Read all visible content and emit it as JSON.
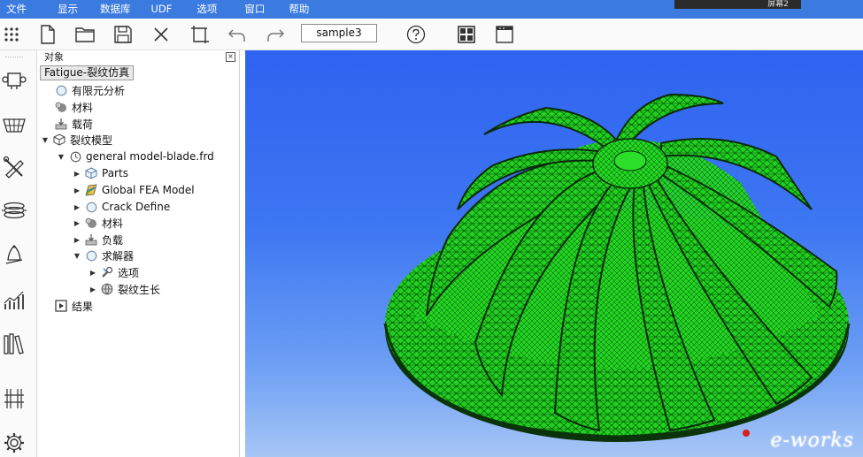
{
  "menu": [
    "文件",
    "显示",
    "数据库",
    "UDF",
    "选项",
    "窗口",
    "帮助"
  ],
  "screen_tag": "屏幕2",
  "toolbar": {
    "project_name": "sample3"
  },
  "panel": {
    "title": "对象",
    "close_glyph": "×"
  },
  "tree": {
    "root": "Fatigue-裂纹仿真",
    "fea": "有限元分析",
    "material": "材料",
    "load": "载荷",
    "crack_model": "裂纹模型",
    "file": "general model-blade.frd",
    "parts": "Parts",
    "global_fea": "Global FEA Model",
    "crack_define": "Crack Define",
    "sub_material": "材料",
    "sub_load": "负载",
    "solver": "求解器",
    "options": "选项",
    "crack_growth": "裂纹生长",
    "results": "结果"
  },
  "watermark": "e-works",
  "colors": {
    "menubar": "#3b7be0",
    "viewport_top": "#2f62f0",
    "viewport_bottom": "#a7c6f6",
    "mesh_green": "#1fd21f"
  }
}
